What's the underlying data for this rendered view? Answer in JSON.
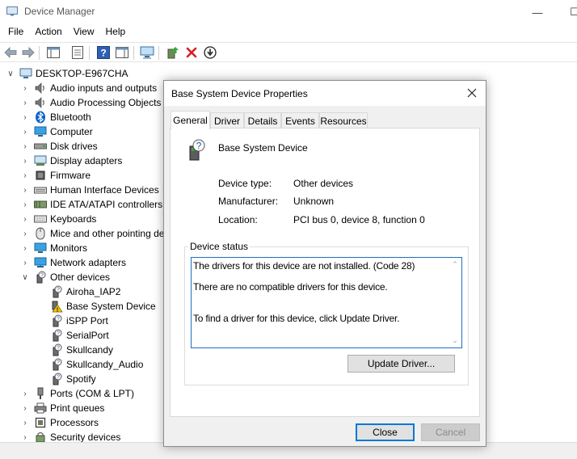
{
  "window": {
    "title": "Device Manager",
    "minimize_glyph": "—",
    "maximize_glyph": "☐"
  },
  "menu": [
    "File",
    "Action",
    "View",
    "Help"
  ],
  "toolbar_icons": [
    "back-arrow-icon",
    "forward-arrow-icon",
    "show-hide-console-tree-icon",
    "properties-sheet-icon",
    "help-icon",
    "action-pane-icon",
    "scan-hardware-icon",
    "update-driver-icon",
    "uninstall-device-icon",
    "disable-device-icon"
  ],
  "tree": {
    "root": "DESKTOP-E967CHA",
    "categories": [
      {
        "label": "Audio inputs and outputs",
        "icon": "speaker-icon",
        "expanded": false
      },
      {
        "label": "Audio Processing Objects",
        "icon": "speaker-icon",
        "expanded": false
      },
      {
        "label": "Bluetooth",
        "icon": "bluetooth-icon",
        "expanded": false
      },
      {
        "label": "Computer",
        "icon": "monitor-icon",
        "expanded": false
      },
      {
        "label": "Disk drives",
        "icon": "disk-drive-icon",
        "expanded": false
      },
      {
        "label": "Display adapters",
        "icon": "display-adapter-icon",
        "expanded": false
      },
      {
        "label": "Firmware",
        "icon": "firmware-chip-icon",
        "expanded": false
      },
      {
        "label": "Human Interface Devices",
        "icon": "hid-icon",
        "expanded": false
      },
      {
        "label": "IDE ATA/ATAPI controllers",
        "icon": "ide-controller-icon",
        "expanded": false
      },
      {
        "label": "Keyboards",
        "icon": "keyboard-icon",
        "expanded": false
      },
      {
        "label": "Mice and other pointing devices",
        "icon": "mouse-icon",
        "expanded": false
      },
      {
        "label": "Monitors",
        "icon": "monitor-icon",
        "expanded": false
      },
      {
        "label": "Network adapters",
        "icon": "network-adapter-icon",
        "expanded": false
      },
      {
        "label": "Other devices",
        "icon": "unknown-device-icon",
        "expanded": true,
        "children": [
          {
            "label": "Airoha_IAP2",
            "icon": "unknown-device-icon"
          },
          {
            "label": "Base System Device",
            "icon": "warning-device-icon"
          },
          {
            "label": "iSPP Port",
            "icon": "unknown-device-icon"
          },
          {
            "label": "SerialPort",
            "icon": "unknown-device-icon"
          },
          {
            "label": "Skullcandy",
            "icon": "unknown-device-icon"
          },
          {
            "label": "Skullcandy_Audio",
            "icon": "unknown-device-icon"
          },
          {
            "label": "Spotify",
            "icon": "unknown-device-icon"
          }
        ]
      },
      {
        "label": "Ports (COM & LPT)",
        "icon": "port-icon",
        "expanded": false
      },
      {
        "label": "Print queues",
        "icon": "printer-icon",
        "expanded": false
      },
      {
        "label": "Processors",
        "icon": "processor-icon",
        "expanded": false
      },
      {
        "label": "Security devices",
        "icon": "security-device-icon",
        "expanded": false
      }
    ]
  },
  "dialog": {
    "title": "Base System Device Properties",
    "tabs": [
      "General",
      "Driver",
      "Details",
      "Events",
      "Resources"
    ],
    "active_tab": "General",
    "device_name": "Base System Device",
    "properties": {
      "device_type_label": "Device type:",
      "device_type_value": "Other devices",
      "manufacturer_label": "Manufacturer:",
      "manufacturer_value": "Unknown",
      "location_label": "Location:",
      "location_value": "PCI bus 0, device 8, function 0"
    },
    "status_group_label": "Device status",
    "status_lines": [
      "The drivers for this device are not installed. (Code 28)",
      "There are no compatible drivers for this device.",
      "To find a driver for this device, click Update Driver."
    ],
    "update_driver_label": "Update Driver...",
    "close_label": "Close",
    "cancel_label": "Cancel"
  },
  "colors": {
    "accent": "#0078d7",
    "bluetooth": "#0a63c9",
    "warning": "#f2c811",
    "delete_red": "#d81e1e"
  }
}
